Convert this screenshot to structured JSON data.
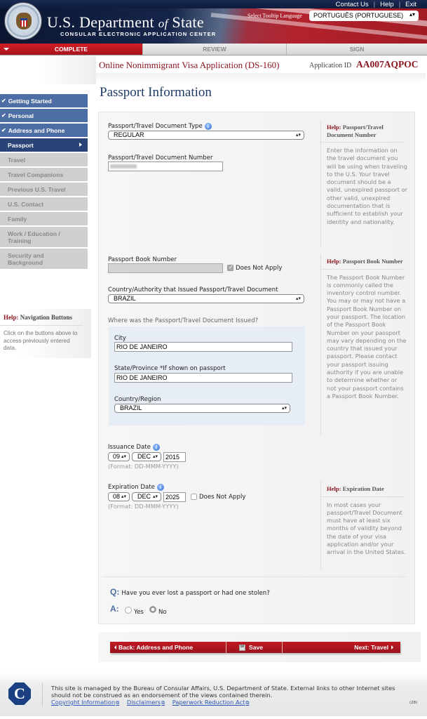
{
  "header": {
    "top_links": [
      "Contact Us",
      "Help",
      "Exit"
    ],
    "dept_title_1": "U.S. Department",
    "dept_title_of": "of",
    "dept_title_2": "State",
    "dept_subtitle": "CONSULAR ELECTRONIC APPLICATION CENTER",
    "tooltip_language_label": "Select Tooltip Language",
    "tooltip_language_value": "PORTUGUÊS (PORTUGUESE)"
  },
  "progress_tabs": [
    {
      "label": "COMPLETE",
      "state": "active"
    },
    {
      "label": "REVIEW",
      "state": "inactive"
    },
    {
      "label": "SIGN",
      "state": "inactive"
    }
  ],
  "application": {
    "title": "Online Nonimmigrant Visa Application (DS-160)",
    "id_label": "Application ID",
    "id_value": "AA007AQPOC"
  },
  "page_title": "Passport Information",
  "sidebar": {
    "items": [
      {
        "label": "Getting Started",
        "state": "done"
      },
      {
        "label": "Personal",
        "state": "done"
      },
      {
        "label": "Address and Phone",
        "state": "done"
      },
      {
        "label": "Passport",
        "state": "active"
      },
      {
        "label": "Travel",
        "state": "todo"
      },
      {
        "label": "Travel Companions",
        "state": "todo"
      },
      {
        "label": "Previous U.S. Travel",
        "state": "todo"
      },
      {
        "label": "U.S. Contact",
        "state": "todo"
      },
      {
        "label": "Family",
        "state": "todo"
      },
      {
        "label": "Work / Education / Training",
        "state": "todo"
      },
      {
        "label": "Security and Background",
        "state": "todo"
      }
    ],
    "help_prefix": "Help:",
    "help_title": "Navigation Buttons",
    "help_text": "Click on the buttons above to access previously entered data."
  },
  "form": {
    "doc_type_label": "Passport/Travel Document Type",
    "doc_type_value": "REGULAR",
    "doc_number_label": "Passport/Travel Document Number",
    "doc_number_value": "",
    "book_number_label": "Passport Book Number",
    "book_number_value": "",
    "book_number_dna_label": "Does Not Apply",
    "book_number_dna_checked": true,
    "issuing_country_label": "Country/Authority that Issued Passport/Travel Document",
    "issuing_country_value": "BRAZIL",
    "issued_where_label": "Where was the Passport/Travel Document Issued?",
    "city_label": "City",
    "city_value": "RIO DE JANEIRO",
    "state_label": "State/Province *If shown on passport",
    "state_value": "RIO DE JANEIRO",
    "country_region_label": "Country/Region",
    "country_region_value": "BRAZIL",
    "issuance_date_label": "Issuance Date",
    "issuance_day": "09",
    "issuance_month": "DEC",
    "issuance_year": "2015",
    "date_format_hint": "(Format: DD-MMM-YYYY)",
    "expiration_date_label": "Expiration Date",
    "expiration_day": "08",
    "expiration_month": "DEC",
    "expiration_year": "2025",
    "expiration_dna_label": "Does Not Apply",
    "expiration_dna_checked": false,
    "lost_question_prefix": "Q:",
    "lost_question": "Have you ever lost a passport or had one stolen?",
    "answer_prefix": "A:",
    "answer_yes": "Yes",
    "answer_no": "No",
    "answer_selected": "No"
  },
  "help_boxes": [
    {
      "prefix": "Help:",
      "title": "Passport/Travel Document Number",
      "text": "Enter the information on the travel document you will be using when traveling to the U.S. Your travel document should be a valid, unexpired passport or other valid, unexpired documentation that is sufficient to establish your identity and nationality."
    },
    {
      "prefix": "Help:",
      "title": "Passport Book Number",
      "text": "The Passport Book Number is commonly called the inventory control number. You may or may not have a Passport Book Number on your passport. The location of the Passport Book Number on your passport may vary depending on the country that issued your passport. Please contact your passport issuing authority if you are unable to determine whether or not your passport contains a Passport Book Number."
    },
    {
      "prefix": "Help:",
      "title": "Expiration Date",
      "text": "In most cases your passport/Travel Document must have at least six months of validity beyond the date of your visa application and/or your arrival in the United States."
    }
  ],
  "nav_buttons": {
    "back": "Back: Address and Phone",
    "save": "Save",
    "next": "Next: Travel"
  },
  "footer": {
    "logo_letter": "C",
    "text": "This site is managed by the Bureau of Consular Affairs, U.S. Department of State. External links to other Internet sites should not be construed as an endorsement of the views contained therein.",
    "links": [
      "Copyright Information",
      "Disclaimers",
      "Paperwork Reduction Act"
    ],
    "page_code": "(28)"
  },
  "colors": {
    "brand_red": "#8a1620",
    "nav_done": "#4d6ea4",
    "nav_active": "#2a4478",
    "nav_todo": "#cfcfcf",
    "button_red": "#b0171f"
  }
}
